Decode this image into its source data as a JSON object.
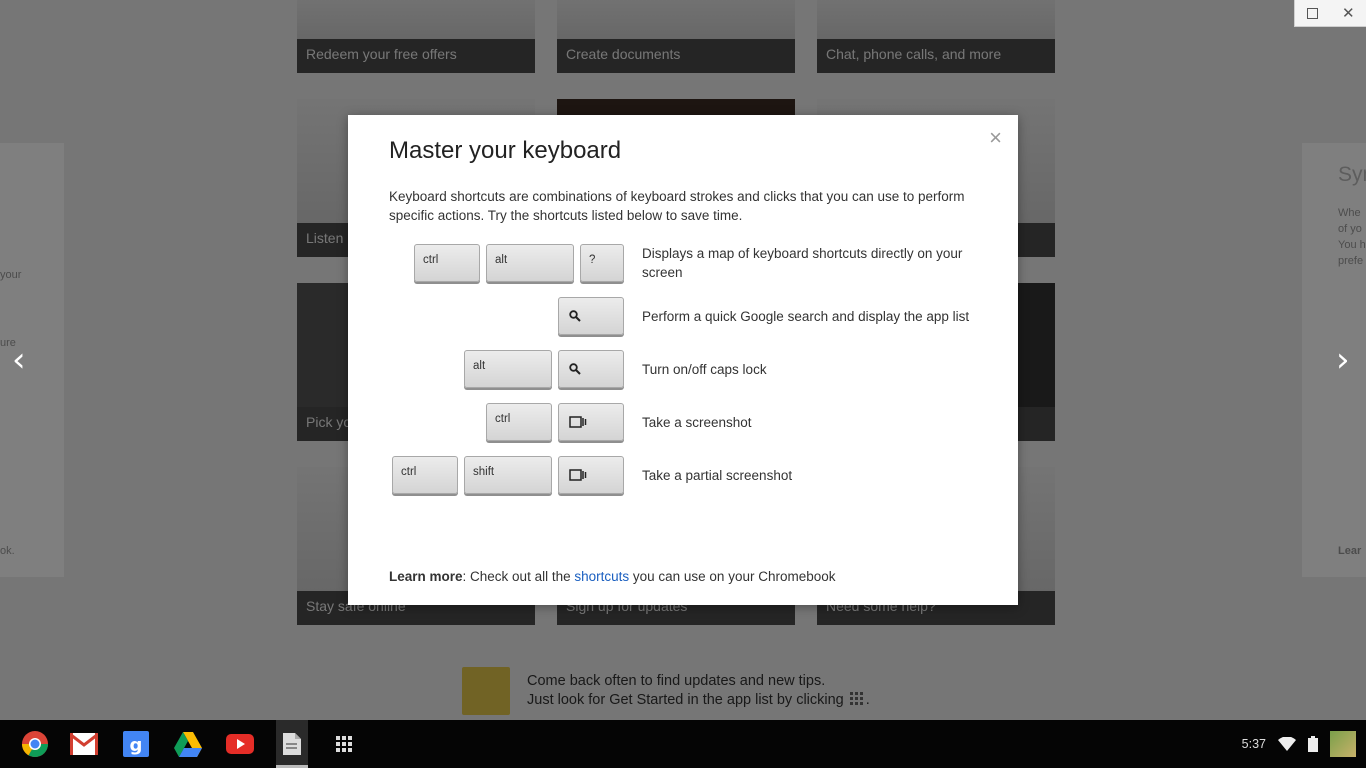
{
  "window_controls": {
    "close_glyph": "✕"
  },
  "tiles": {
    "row1": [
      "Redeem your free offers",
      "Create documents",
      "Chat, phone calls, and more"
    ],
    "row2": [
      "Listen",
      "",
      ""
    ],
    "row3": [
      "Pick yo",
      "",
      ""
    ],
    "row4": [
      "Stay safe online",
      "Sign up for updates",
      "Need some help?"
    ]
  },
  "side_right": {
    "title": "Syn",
    "lines": [
      "Whe",
      "of yo",
      "You h",
      "prefe"
    ],
    "learn": "Lear"
  },
  "side_left": {
    "lines": [
      "your",
      "ure",
      "ok."
    ]
  },
  "nav": {
    "prev": "‹",
    "next": "›"
  },
  "dialog": {
    "close_glyph": "×",
    "title": "Master your keyboard",
    "intro": "Keyboard shortcuts are combinations of keyboard strokes and clicks that you can use to perform specific actions. Try the shortcuts listed below to save time.",
    "shortcuts": [
      {
        "keys": [
          "ctrl",
          "alt",
          "?"
        ],
        "description": "Displays a map of keyboard shortcuts directly on your screen"
      },
      {
        "keys": [
          "search-icon"
        ],
        "description": "Perform a quick Google search and display the app list"
      },
      {
        "keys": [
          "alt",
          "search-icon"
        ],
        "description": "Turn on/off caps lock"
      },
      {
        "keys": [
          "ctrl",
          "window-switcher-icon"
        ],
        "description": "Take a screenshot"
      },
      {
        "keys": [
          "ctrl",
          "shift",
          "window-switcher-icon"
        ],
        "description": "Take a partial screenshot"
      }
    ],
    "learn_more": {
      "label": "Learn more",
      "before": ": Check out all the ",
      "link": "shortcuts",
      "after": " you can use on your Chromebook"
    }
  },
  "tip": {
    "line1": "Come back often to find updates and new tips.",
    "line2_before": "Just look for Get Started in the app list by clicking",
    "line2_after": "."
  },
  "shelf": {
    "apps": [
      "chrome-icon",
      "gmail-icon",
      "google-search-icon",
      "drive-icon",
      "youtube-icon",
      "get-started-icon",
      "app-launcher-icon"
    ],
    "clock": "5:37"
  },
  "colors": {
    "link": "#1a5fc0",
    "shelf": "#050505",
    "overlay": "rgba(0,0,0,0.5)"
  }
}
